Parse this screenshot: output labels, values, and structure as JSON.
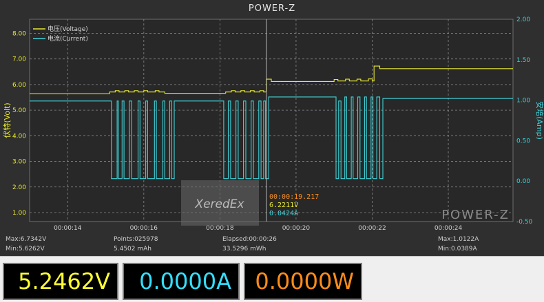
{
  "window": {
    "title": "POWER-Z"
  },
  "chart_data": {
    "type": "line",
    "title": "POWER-Z",
    "xlabel": "",
    "ylabel_left": "伏特(Volt)",
    "ylabel_right": "安培(Amp)",
    "x_ticks": [
      "00:00:14",
      "00:00:16",
      "00:00:18",
      "00:00:20",
      "00:00:22",
      "00:00:24"
    ],
    "y_left_ticks": [
      "1.00",
      "2.00",
      "3.00",
      "4.00",
      "5.00",
      "6.00",
      "7.00",
      "8.00"
    ],
    "y_right_ticks": [
      "-0.50",
      "0.00",
      "0.50",
      "1.00",
      "1.50",
      "2.00"
    ],
    "ylim_left": [
      0.65,
      8.55
    ],
    "ylim_right": [
      -0.5,
      2.0
    ],
    "xlim_seconds": [
      13.0,
      25.7
    ],
    "grid": true,
    "legend_position": "top-left",
    "series": [
      {
        "name": "电压(Voltage)",
        "color": "#e8e830",
        "axis": "left",
        "unit": "V",
        "points": [
          [
            13.0,
            5.64
          ],
          [
            15.1,
            5.64
          ],
          [
            15.1,
            5.71
          ],
          [
            15.25,
            5.71
          ],
          [
            15.25,
            5.76
          ],
          [
            15.35,
            5.76
          ],
          [
            15.35,
            5.71
          ],
          [
            15.5,
            5.71
          ],
          [
            15.5,
            5.76
          ],
          [
            15.6,
            5.76
          ],
          [
            15.6,
            5.71
          ],
          [
            15.75,
            5.71
          ],
          [
            15.75,
            5.76
          ],
          [
            15.85,
            5.76
          ],
          [
            15.85,
            5.71
          ],
          [
            16.0,
            5.71
          ],
          [
            16.0,
            5.76
          ],
          [
            16.1,
            5.76
          ],
          [
            16.1,
            5.71
          ],
          [
            16.3,
            5.71
          ],
          [
            16.3,
            5.76
          ],
          [
            16.4,
            5.76
          ],
          [
            16.4,
            5.71
          ],
          [
            16.55,
            5.71
          ],
          [
            16.55,
            5.66
          ],
          [
            18.15,
            5.66
          ],
          [
            18.15,
            5.71
          ],
          [
            18.3,
            5.71
          ],
          [
            18.3,
            5.76
          ],
          [
            18.4,
            5.76
          ],
          [
            18.4,
            5.71
          ],
          [
            18.55,
            5.71
          ],
          [
            18.55,
            5.76
          ],
          [
            18.65,
            5.76
          ],
          [
            18.65,
            5.71
          ],
          [
            18.8,
            5.71
          ],
          [
            18.8,
            5.76
          ],
          [
            18.9,
            5.76
          ],
          [
            18.9,
            5.71
          ],
          [
            19.05,
            5.71
          ],
          [
            19.05,
            5.76
          ],
          [
            19.15,
            5.76
          ],
          [
            19.15,
            5.71
          ],
          [
            19.22,
            5.71
          ],
          [
            19.22,
            6.21
          ],
          [
            19.35,
            6.21
          ],
          [
            19.35,
            6.12
          ],
          [
            21.0,
            6.12
          ],
          [
            21.0,
            6.2
          ],
          [
            21.1,
            6.2
          ],
          [
            21.1,
            6.14
          ],
          [
            21.3,
            6.14
          ],
          [
            21.3,
            6.21
          ],
          [
            21.4,
            6.21
          ],
          [
            21.4,
            6.14
          ],
          [
            21.6,
            6.14
          ],
          [
            21.6,
            6.21
          ],
          [
            21.7,
            6.21
          ],
          [
            21.7,
            6.14
          ],
          [
            21.9,
            6.14
          ],
          [
            21.9,
            6.22
          ],
          [
            22.0,
            6.22
          ],
          [
            22.0,
            6.14
          ],
          [
            22.05,
            6.14
          ],
          [
            22.05,
            6.72
          ],
          [
            22.2,
            6.72
          ],
          [
            22.2,
            6.62
          ],
          [
            25.7,
            6.62
          ]
        ]
      },
      {
        "name": "电流(Current)",
        "color": "#3ed2d8",
        "axis": "right",
        "unit": "A",
        "points": [
          [
            13.0,
            0.99
          ],
          [
            15.15,
            0.99
          ],
          [
            15.15,
            0.03
          ],
          [
            15.3,
            0.03
          ],
          [
            15.3,
            0.99
          ],
          [
            15.33,
            0.99
          ],
          [
            15.33,
            0.03
          ],
          [
            15.43,
            0.03
          ],
          [
            15.43,
            0.99
          ],
          [
            15.48,
            0.99
          ],
          [
            15.48,
            0.03
          ],
          [
            15.62,
            0.03
          ],
          [
            15.62,
            0.99
          ],
          [
            15.68,
            0.99
          ],
          [
            15.68,
            0.03
          ],
          [
            15.85,
            0.03
          ],
          [
            15.85,
            0.99
          ],
          [
            15.9,
            0.99
          ],
          [
            15.9,
            0.03
          ],
          [
            16.05,
            0.03
          ],
          [
            16.05,
            0.99
          ],
          [
            16.1,
            0.99
          ],
          [
            16.1,
            0.03
          ],
          [
            16.28,
            0.03
          ],
          [
            16.28,
            0.99
          ],
          [
            16.33,
            0.99
          ],
          [
            16.33,
            0.03
          ],
          [
            16.5,
            0.03
          ],
          [
            16.5,
            0.99
          ],
          [
            16.55,
            0.99
          ],
          [
            16.55,
            0.03
          ],
          [
            16.68,
            0.03
          ],
          [
            16.68,
            0.99
          ],
          [
            16.73,
            0.99
          ],
          [
            16.73,
            0.03
          ],
          [
            16.8,
            0.03
          ],
          [
            16.8,
            0.99
          ],
          [
            18.1,
            0.99
          ],
          [
            18.1,
            0.03
          ],
          [
            18.22,
            0.03
          ],
          [
            18.22,
            0.99
          ],
          [
            18.28,
            0.99
          ],
          [
            18.28,
            0.03
          ],
          [
            18.42,
            0.03
          ],
          [
            18.42,
            0.99
          ],
          [
            18.48,
            0.99
          ],
          [
            18.48,
            0.03
          ],
          [
            18.62,
            0.03
          ],
          [
            18.62,
            0.99
          ],
          [
            18.68,
            0.99
          ],
          [
            18.68,
            0.03
          ],
          [
            18.82,
            0.03
          ],
          [
            18.82,
            0.99
          ],
          [
            18.88,
            0.99
          ],
          [
            18.88,
            0.03
          ],
          [
            19.02,
            0.03
          ],
          [
            19.02,
            0.99
          ],
          [
            19.08,
            0.99
          ],
          [
            19.08,
            0.03
          ],
          [
            19.15,
            0.03
          ],
          [
            19.15,
            0.99
          ],
          [
            19.2,
            0.99
          ],
          [
            19.2,
            0.03
          ],
          [
            19.28,
            0.03
          ],
          [
            19.28,
            1.04
          ],
          [
            21.05,
            1.04
          ],
          [
            21.05,
            0.03
          ],
          [
            21.12,
            0.03
          ],
          [
            21.12,
            0.99
          ],
          [
            21.18,
            0.99
          ],
          [
            21.18,
            0.03
          ],
          [
            21.28,
            0.03
          ],
          [
            21.28,
            1.04
          ],
          [
            21.33,
            1.04
          ],
          [
            21.33,
            0.03
          ],
          [
            21.45,
            0.03
          ],
          [
            21.45,
            1.04
          ],
          [
            21.5,
            1.04
          ],
          [
            21.5,
            0.03
          ],
          [
            21.62,
            0.03
          ],
          [
            21.62,
            1.04
          ],
          [
            21.68,
            1.04
          ],
          [
            21.68,
            0.03
          ],
          [
            21.8,
            0.03
          ],
          [
            21.8,
            1.04
          ],
          [
            21.85,
            1.04
          ],
          [
            21.85,
            0.03
          ],
          [
            21.97,
            0.03
          ],
          [
            21.97,
            1.04
          ],
          [
            22.02,
            1.04
          ],
          [
            22.02,
            0.03
          ],
          [
            22.12,
            0.03
          ],
          [
            22.12,
            1.04
          ],
          [
            22.2,
            1.04
          ],
          [
            22.2,
            0.03
          ],
          [
            22.28,
            0.03
          ],
          [
            22.28,
            1.02
          ],
          [
            25.7,
            1.02
          ]
        ]
      }
    ],
    "cursor": {
      "x": 19.217,
      "time": "00:00:19.217",
      "voltage": "6.2211V",
      "current": "0.0424A"
    }
  },
  "stats": {
    "max_v": "Max:6.7342V",
    "min_v": "Min:5.6262V",
    "points": "Points:025978",
    "mah": "5.4502 mAh",
    "elapsed": "Elapsed:00:00:26",
    "mwh": "33.5296 mWh",
    "max_a": "Max:1.0122A",
    "min_a": "Min:0.0389A"
  },
  "watermarks": {
    "center": "XeredEx",
    "corner": "POWER-Z"
  },
  "readouts": {
    "voltage": "5.2462V",
    "current": "0.0000A",
    "power": "0.0000W",
    "colors": {
      "voltage": "#ffff33",
      "current": "#33e0ff",
      "power": "#ff8c1a"
    }
  }
}
